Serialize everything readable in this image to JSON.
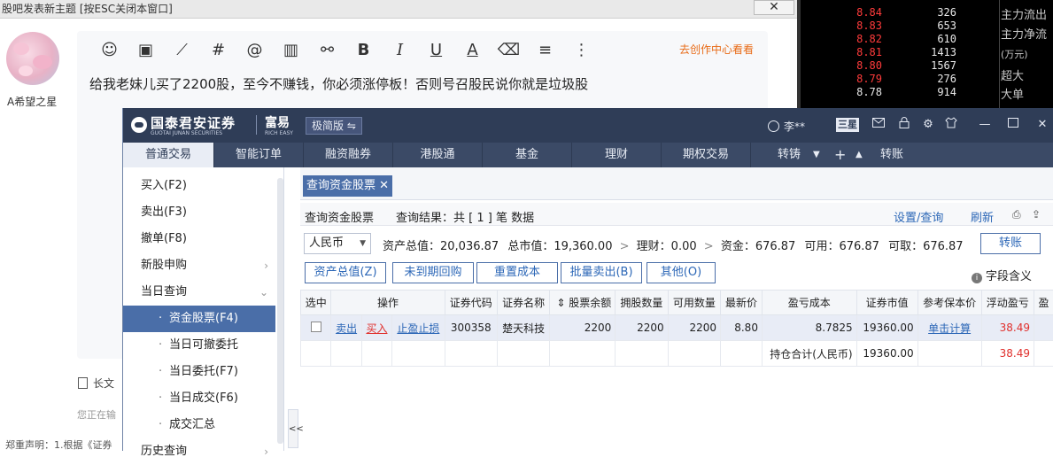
{
  "forum": {
    "window_title": "股吧发表新主题 [按ESC关闭本窗口]",
    "close_glyph": "✕",
    "username": "A希望之星",
    "goto_creator_center": "去创作中心看看",
    "post_text": "给我老妹儿买了2200股，至今不赚钱，你必须涨停板！否则号召股民说你就是垃圾股",
    "long_text_label": "长文",
    "typing_status": "您正在输",
    "disclaimer": "郑重声明：1.根据《证券",
    "tools": [
      {
        "name": "emoji-icon",
        "glyph": "☺"
      },
      {
        "name": "image-icon",
        "glyph": "▣"
      },
      {
        "name": "stock-chart-icon",
        "glyph": "⟋"
      },
      {
        "name": "topic-hash-icon",
        "glyph": "#"
      },
      {
        "name": "mention-icon",
        "glyph": "@"
      },
      {
        "name": "bar-chart-icon",
        "glyph": "▥"
      },
      {
        "name": "link-icon",
        "glyph": "⚯"
      },
      {
        "name": "bold-icon",
        "glyph": "B"
      },
      {
        "name": "italic-icon",
        "glyph": "I"
      },
      {
        "name": "underline-icon",
        "glyph": "U"
      },
      {
        "name": "font-color-icon",
        "glyph": "A"
      },
      {
        "name": "eraser-icon",
        "glyph": "⌫"
      },
      {
        "name": "align-icon",
        "glyph": "≡"
      },
      {
        "name": "more-icon",
        "glyph": "⋮"
      }
    ]
  },
  "ticker": {
    "rows": [
      {
        "price": "8.84",
        "vol": "326",
        "color": "#ff3b3b"
      },
      {
        "price": "8.83",
        "vol": "653",
        "color": "#ff3b3b"
      },
      {
        "price": "8.82",
        "vol": "610",
        "color": "#ff3b3b"
      },
      {
        "price": "8.81",
        "vol": "1413",
        "color": "#ff3b3b"
      },
      {
        "price": "8.80",
        "vol": "1567",
        "color": "#ff3b3b"
      },
      {
        "price": "8.79",
        "vol": "276",
        "color": "#ff3b3b"
      },
      {
        "price": "8.78",
        "vol": "914",
        "color": "#e8e8e8"
      }
    ],
    "labels": [
      "主力流出",
      "主力净流",
      "(万元)",
      "超大",
      "大单"
    ]
  },
  "app": {
    "brand": "国泰君安证券",
    "brand_en": "GUOTAI JUNAN SECURITIES",
    "rich": "富易",
    "rich_en": "RICH EASY",
    "version": "极简版 ⇋",
    "user": "李**",
    "sanxing": "三星",
    "icons": [
      "mail-icon",
      "lock-icon",
      "settings-icon",
      "skin-icon",
      "minimize-icon",
      "maximize-icon",
      "close-icon"
    ]
  },
  "nav": {
    "tabs": [
      "普通交易",
      "智能订单",
      "融资融券",
      "港股通",
      "基金",
      "理财",
      "期权交易",
      "转铸"
    ],
    "extra": "转账"
  },
  "sidebar": {
    "items": [
      {
        "label": "买入(F2)",
        "type": "top"
      },
      {
        "label": "卖出(F3)",
        "type": "top"
      },
      {
        "label": "撤单(F8)",
        "type": "top"
      },
      {
        "label": "新股申购",
        "type": "top",
        "chev": "›"
      },
      {
        "label": "当日查询",
        "type": "top",
        "chev": "⌄"
      },
      {
        "label": "资金股票(F4)",
        "type": "sub",
        "active": true
      },
      {
        "label": "当日可撤委托",
        "type": "sub"
      },
      {
        "label": "当日委托(F7)",
        "type": "sub"
      },
      {
        "label": "当日成交(F6)",
        "type": "sub"
      },
      {
        "label": "成交汇总",
        "type": "sub"
      },
      {
        "label": "历史查询",
        "type": "top",
        "chev": "›"
      }
    ],
    "collapse": "<<"
  },
  "content": {
    "tab_label": "查询资金股票 ✕",
    "query_title": "查询资金股票",
    "query_result": "查询结果：共 [ 1 ] 笔 数据",
    "settings_label": "设置/查询",
    "refresh_label": "刷新",
    "currency": "人民币",
    "summary": {
      "total_assets": "资产总值：20,036.87",
      "market_value": "总市值：19,360.00",
      "wealth": "理财：0.00",
      "funds": "资金：676.87",
      "available": "可用：676.87",
      "withdrawable": "可取：676.87"
    },
    "transfer_btn": "转账",
    "action_buttons": [
      "资产总值(Z)",
      "未到期回购",
      "重置成本",
      "批量卖出(B)",
      "其他(O)"
    ],
    "field_meaning": "字段含义",
    "table": {
      "headers": [
        "选中",
        "操作",
        "证券代码",
        "证券名称",
        "股票余额",
        "拥股数量",
        "可用数量",
        "最新价",
        "盈亏成本",
        "证券市值",
        "参考保本价",
        "浮动盈亏",
        "盈"
      ],
      "row": {
        "sell": "卖出",
        "buy": "买入",
        "stop": "止盈止损",
        "code": "300358",
        "name": "楚天科技",
        "balance": "2200",
        "holding": "2200",
        "available": "2200",
        "last_price": "8.80",
        "cost": "8.7825",
        "market_value": "19360.00",
        "breakeven": "单击计算",
        "float_pl": "38.49"
      },
      "total": {
        "label": "持仓合计(人民币)",
        "market_value": "19360.00",
        "float_pl": "38.49"
      }
    }
  }
}
